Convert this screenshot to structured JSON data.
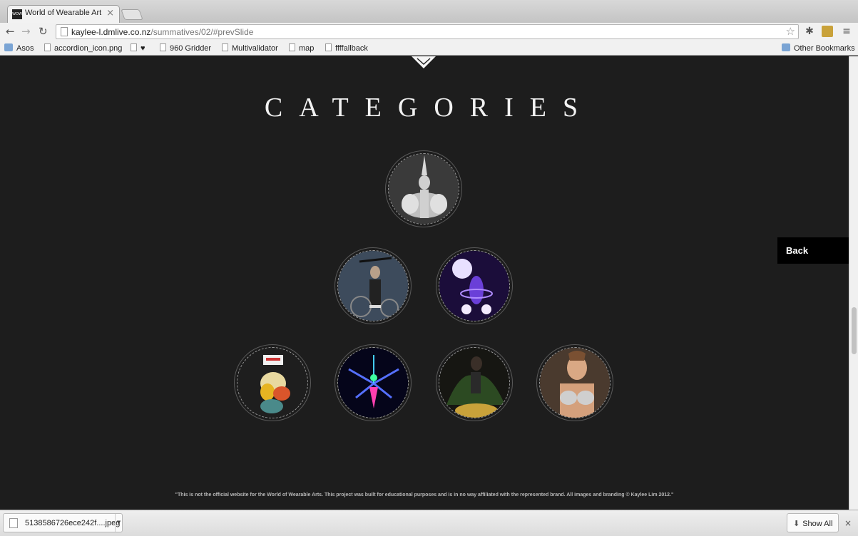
{
  "browser": {
    "tab_title": "World of Wearable Art",
    "tab_favicon_text": "WOW",
    "tab_close": "×",
    "url_domain": "kaylee-l.dmlive.co.nz",
    "url_path": "/summatives/02/#prevSlide",
    "bookmarks": [
      "Asos",
      "accordion_icon.png",
      "♥",
      "960 Gridder",
      "Multivalidator",
      "map",
      "ffffallback"
    ],
    "other_bookmarks": "Other Bookmarks"
  },
  "page": {
    "heading": "CATEGORIES",
    "back_label": "Back",
    "disclaimer": "\"This is not the official website for the World of Wearable Arts. This project was built for educational purposes and is in no way affiliated with the represented brand. All images and branding © Kaylee Lim 2012.\""
  },
  "categories": [
    {
      "icon": "silver-costume-image"
    },
    {
      "icon": "steampunk-costume-image"
    },
    {
      "icon": "glowing-purple-costume-image"
    },
    {
      "icon": "colorful-sculpture-costume-image"
    },
    {
      "icon": "neon-uv-costume-image"
    },
    {
      "icon": "dark-green-costume-image"
    },
    {
      "icon": "bra-costume-image"
    }
  ],
  "downloads": {
    "file_name": "5138586726ece242f....jpeg",
    "show_all": "Show All",
    "close": "×"
  },
  "colors": {
    "page_background": "#1d1d1d",
    "heading": "#f2f2f2",
    "back_button": "#000000"
  }
}
